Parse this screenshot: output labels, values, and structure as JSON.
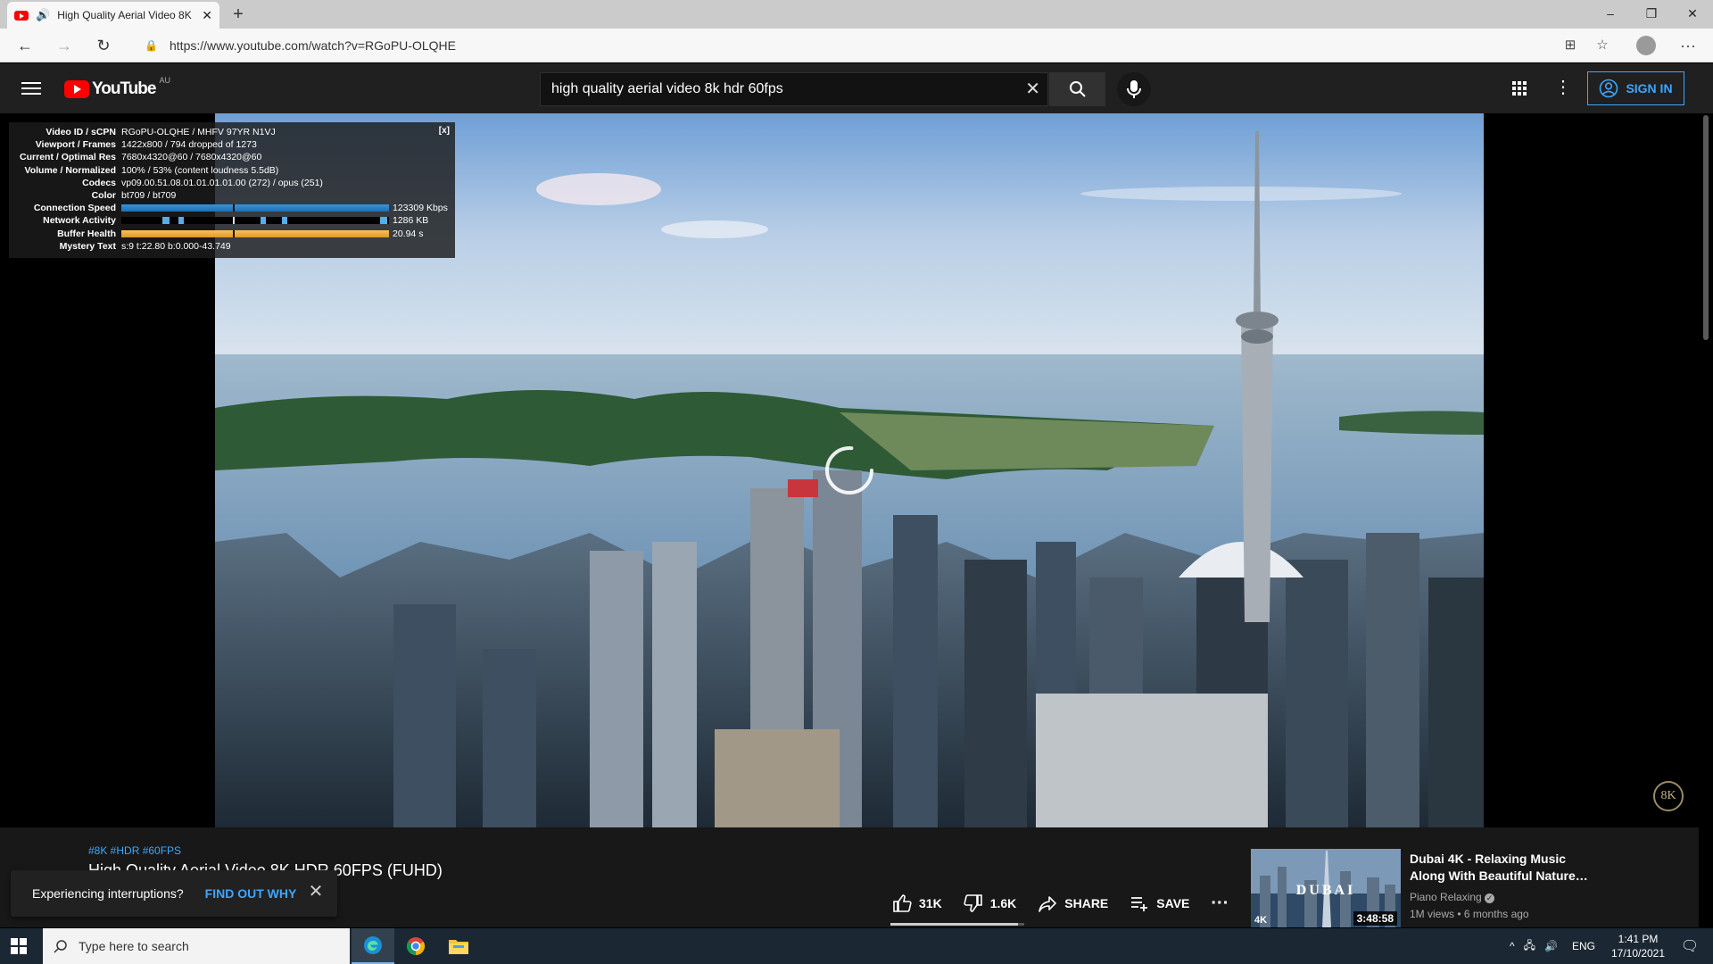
{
  "browser": {
    "tab_title": "High Quality Aerial Video 8K",
    "url": "https://www.youtube.com/watch?v=RGoPU-OLQHE",
    "new_tab": "+",
    "window_minimize": "–",
    "window_restore": "❐",
    "window_close": "✕"
  },
  "masthead": {
    "logo_text": "YouTube",
    "country_code": "AU",
    "search_value": "high quality aerial video 8k hdr 60fps",
    "sign_in_label": "SIGN IN"
  },
  "stats": {
    "close_label": "[x]",
    "rows": [
      {
        "key": "Video ID / sCPN",
        "value": "RGoPU-OLQHE / MHFV 97YR N1VJ"
      },
      {
        "key": "Viewport / Frames",
        "value": "1422x800 / 794 dropped of 1273"
      },
      {
        "key": "Current / Optimal Res",
        "value": "7680x4320@60 / 7680x4320@60"
      },
      {
        "key": "Volume / Normalized",
        "value": "100% / 53% (content loudness 5.5dB)"
      },
      {
        "key": "Codecs",
        "value": "vp09.00.51.08.01.01.01.01.00 (272) / opus (251)"
      },
      {
        "key": "Color",
        "value": "bt709 / bt709"
      }
    ],
    "connection_label": "Connection Speed",
    "connection_value": "123309 Kbps",
    "network_label": "Network Activity",
    "network_value": "1286 KB",
    "buffer_label": "Buffer Health",
    "buffer_value": "20.94 s",
    "mystery_label": "Mystery Text",
    "mystery_value": "s:9 t:22.80 b:0.000-43.749"
  },
  "watermark": "8K",
  "video": {
    "hashtags": "#8K #HDR #60FPS",
    "title": "High Quality Aerial Video 8K HDR 60FPS (FUHD)",
    "likes": "31K",
    "dislikes": "1.6K",
    "share_label": "SHARE",
    "save_label": "SAVE",
    "like_ratio": 0.95
  },
  "recommendation": {
    "title": "Dubai 4K - Relaxing Music Along With Beautiful Nature…",
    "channel": "Piano Relaxing",
    "meta": "1M views • 6 months ago",
    "duration": "3:48:58",
    "thumb_text": "DUBAI",
    "badge": "4K"
  },
  "toast": {
    "message": "Experiencing interruptions?",
    "action": "FIND OUT WHY"
  },
  "taskbar": {
    "search_placeholder": "Type here to search",
    "language": "ENG",
    "time": "1:41 PM",
    "date": "17/10/2021"
  },
  "colors": {
    "accent_blue": "#3ea6ff",
    "youtube_red": "#ff0000",
    "masthead_bg": "#202020",
    "taskbar_bg": "#1b2733"
  }
}
